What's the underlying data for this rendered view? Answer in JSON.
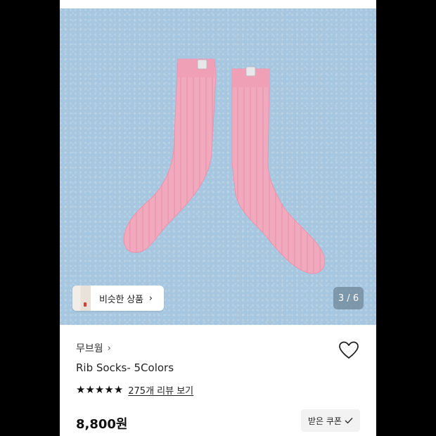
{
  "gallery": {
    "similar_button": {
      "label": "비슷한 상품",
      "chevron": "›"
    },
    "counter": "3 / 6",
    "product_image": "pink-rib-socks-photo"
  },
  "product": {
    "brand": "무브웜",
    "brand_chevron": "›",
    "name": "Rib Socks- 5Colors",
    "rating_stars": 5,
    "review_link": "275개 리뷰 보기",
    "price": "8,800원",
    "coupon_button": {
      "label": "받은 쿠폰",
      "icon": "check-icon"
    },
    "wishlist_icon": "heart-outline-icon"
  },
  "colors": {
    "hero_background": "#a7c7e0",
    "sock": "#f0a9bd"
  }
}
